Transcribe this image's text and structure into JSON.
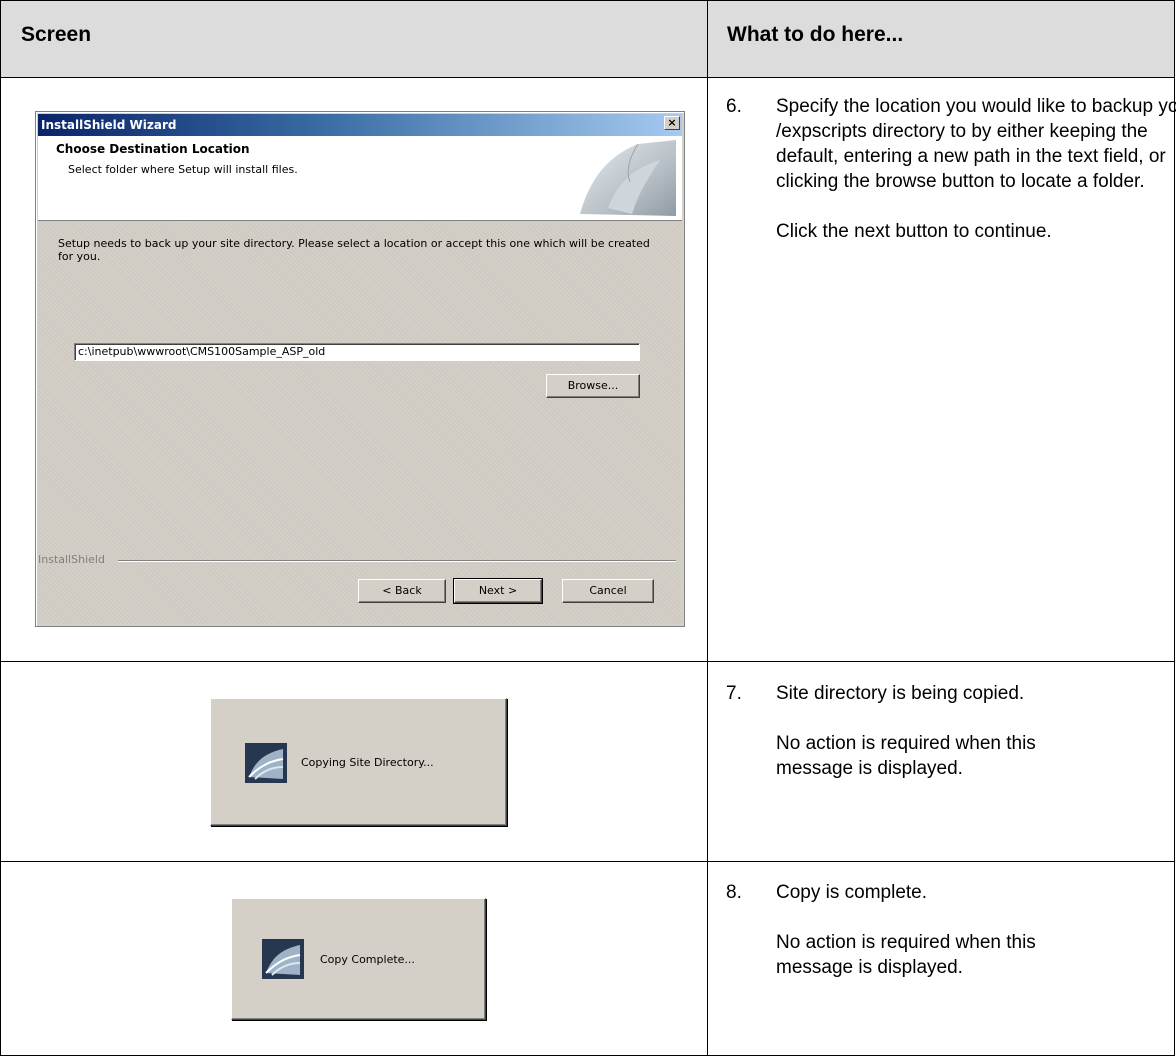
{
  "table": {
    "col_screen": "Screen",
    "col_todo": "What to do here..."
  },
  "rows": [
    {
      "num": "6.",
      "lines": [
        "Specify the location you would like to backup your /expscripts directory to by either keeping the default, entering a new path in the text field, or clicking the browse button to locate a folder.",
        "Click the next button to continue."
      ]
    },
    {
      "num": "7.",
      "lines": [
        "Site directory is being copied.",
        "No action is required when this message is displayed."
      ]
    },
    {
      "num": "8.",
      "lines": [
        "Copy is complete.",
        "No action is required when this message is displayed."
      ]
    }
  ],
  "wizard": {
    "title": "InstallShield Wizard",
    "close_glyph": "×",
    "header_title": "Choose Destination Location",
    "header_subtitle": "Select folder where Setup will install files.",
    "description": "Setup needs to back up your site directory. Please select a location or accept this one which will be created for you.",
    "path_value": "c:\\inetpub\\wwwroot\\CMS100Sample_ASP_old",
    "browse_label": "Browse...",
    "footer_brand": "InstallShield",
    "back_label": "< Back",
    "next_label": "Next >",
    "cancel_label": "Cancel"
  },
  "dialog_copying": {
    "text": "Copying Site Directory..."
  },
  "dialog_complete": {
    "text": "Copy Complete..."
  }
}
